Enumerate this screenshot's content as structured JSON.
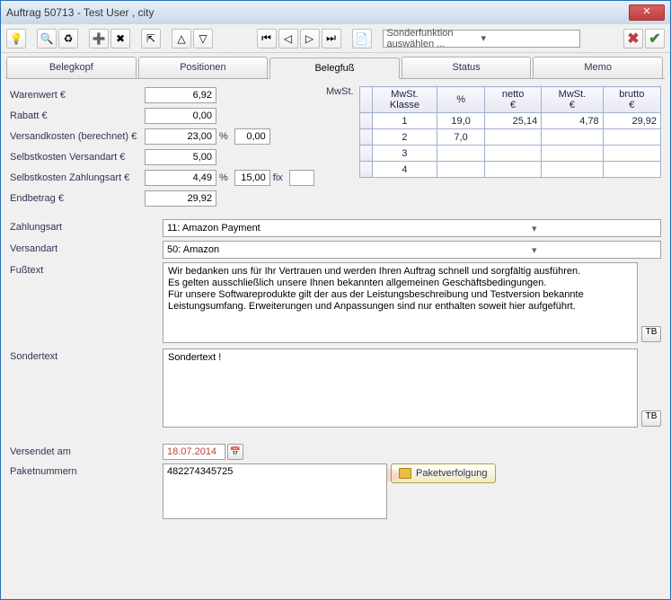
{
  "window": {
    "title": "Auftrag 50713 - Test User , city"
  },
  "toolbar": {
    "combo_placeholder": "Sonderfunktion auswählen ..."
  },
  "tabs": {
    "belegkopf": "Belegkopf",
    "positionen": "Positionen",
    "belegfuss": "Belegfuß",
    "status": "Status",
    "memo": "Memo"
  },
  "labels": {
    "warenwert": "Warenwert €",
    "rabatt": "Rabatt €",
    "versandkosten_berechnet": "Versandkosten (berechnet) €",
    "selbstkosten_versandart": "Selbstkosten Versandart €",
    "selbstkosten_zahlungsart": "Selbstkosten Zahlungsart €",
    "endbetrag": "Endbetrag €",
    "mwst": "MwSt.",
    "zahlungsart": "Zahlungsart",
    "versandart": "Versandart",
    "fusstext": "Fußtext",
    "sondertext": "Sondertext",
    "versendet_am": "Versendet am",
    "paketnummern": "Paketnummern",
    "fix": "fix",
    "tb": "TB",
    "paketverfolgung": "Paketverfolgung"
  },
  "values": {
    "warenwert": "6,92",
    "rabatt": "0,00",
    "versandkosten_berechnet": "23,00",
    "versandkosten_pct": "0,00",
    "selbstkosten_versandart": "5,00",
    "selbstkosten_zahlungsart": "4,49",
    "selbstkosten_zahlungsart_pct": "15,00",
    "selbstkosten_zahlungsart_fix": "",
    "endbetrag": "29,92",
    "zahlungsart": "11: Amazon Payment",
    "versandart": "50: Amazon",
    "fusstext": "Wir bedanken uns für Ihr Vertrauen und werden Ihren Auftrag schnell und sorgfältig ausführen.\nEs gelten ausschließlich unsere Ihnen bekannten allgemeinen Geschäftsbedingungen.\nFür unsere Softwareprodukte gilt der aus der Leistungsbeschreibung und Testversion bekannte\nLeistungsumfang. Erweiterungen und Anpassungen sind nur enthalten soweit hier aufgeführt.",
    "sondertext": "Sondertext !",
    "versendet_am": "18.07.2014",
    "paketnummern": "482274345725"
  },
  "mwst_table": {
    "headers": {
      "klasse": "MwSt.\nKlasse",
      "pct": "%",
      "netto": "netto\n€",
      "mwst": "MwSt.\n€",
      "brutto": "brutto\n€"
    },
    "rows": [
      {
        "klasse": "1",
        "pct": "19,0",
        "netto": "25,14",
        "mwst": "4,78",
        "brutto": "29,92"
      },
      {
        "klasse": "2",
        "pct": "7,0",
        "netto": "",
        "mwst": "",
        "brutto": ""
      },
      {
        "klasse": "3",
        "pct": "",
        "netto": "",
        "mwst": "",
        "brutto": ""
      },
      {
        "klasse": "4",
        "pct": "",
        "netto": "",
        "mwst": "",
        "brutto": ""
      }
    ]
  }
}
